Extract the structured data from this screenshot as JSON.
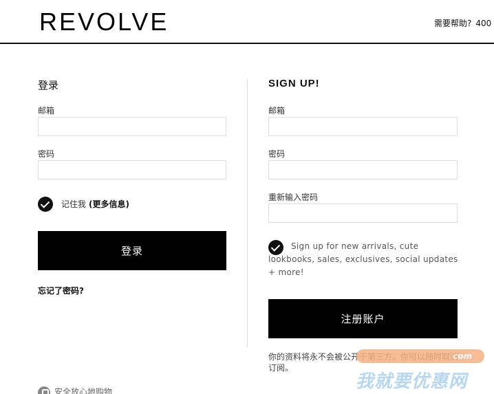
{
  "header": {
    "logo": "REVOLVE",
    "help_label": "需要帮助?",
    "help_phone": "400"
  },
  "login": {
    "title": "登录",
    "email_label": "邮箱",
    "email_value": "",
    "password_label": "密码",
    "password_value": "",
    "remember_label": "记住我",
    "more_info": "(更多信息)",
    "submit_label": "登录",
    "forgot_label": "忘记了密码?"
  },
  "signup": {
    "title": "SIGN UP!",
    "email_label": "邮箱",
    "email_value": "",
    "password_label": "密码",
    "password_value": "",
    "confirm_label": "重新输入密码",
    "confirm_value": "",
    "newsletter_text": "Sign up for new arrivals, cute lookbooks, sales, exclusives, social updates + more!",
    "submit_label": "注册账户",
    "privacy_text": "你的资料将永不会被公开于第三方。你可以随时取消订阅。"
  },
  "footer": {
    "secure_label": "安全放心地购物"
  },
  "watermark": {
    "badge": "com",
    "text": "我就要优惠网"
  },
  "colors": {
    "primary": "#000000",
    "border": "#dcdcdc",
    "watermark_orange": "#f4b183",
    "watermark_blue": "#b7d7f0"
  }
}
